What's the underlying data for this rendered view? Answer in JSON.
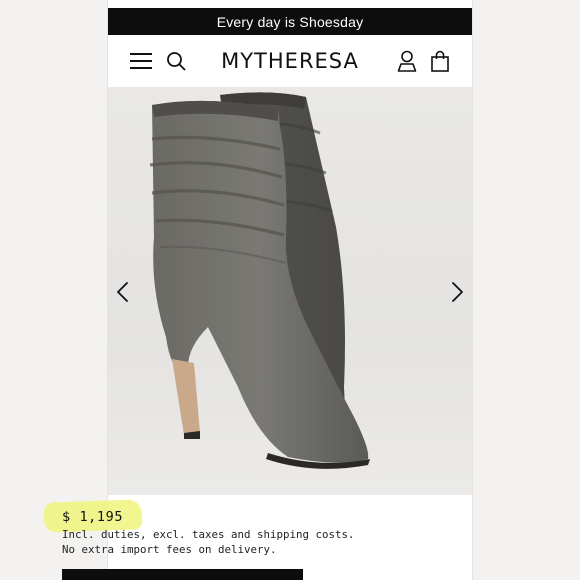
{
  "promo": {
    "text": "Every day is Shoesday"
  },
  "header": {
    "logo": "MYTHERESA",
    "icons": [
      "menu-icon",
      "search-icon",
      "account-icon",
      "shopping-bag-icon"
    ]
  },
  "gallery": {
    "icons": [
      "chevron-left-icon",
      "chevron-right-icon"
    ],
    "background": "#e7e6e4",
    "boot_color": "#5f5e5a"
  },
  "product": {
    "price": "$ 1,195",
    "duties_note": "Incl. duties, excl. taxes and shipping costs.",
    "import_note": "No extra import fees on delivery."
  },
  "colors": {
    "promo_bg": "#0d0d0d",
    "highlight": "#eef57a",
    "text": "#111111"
  }
}
